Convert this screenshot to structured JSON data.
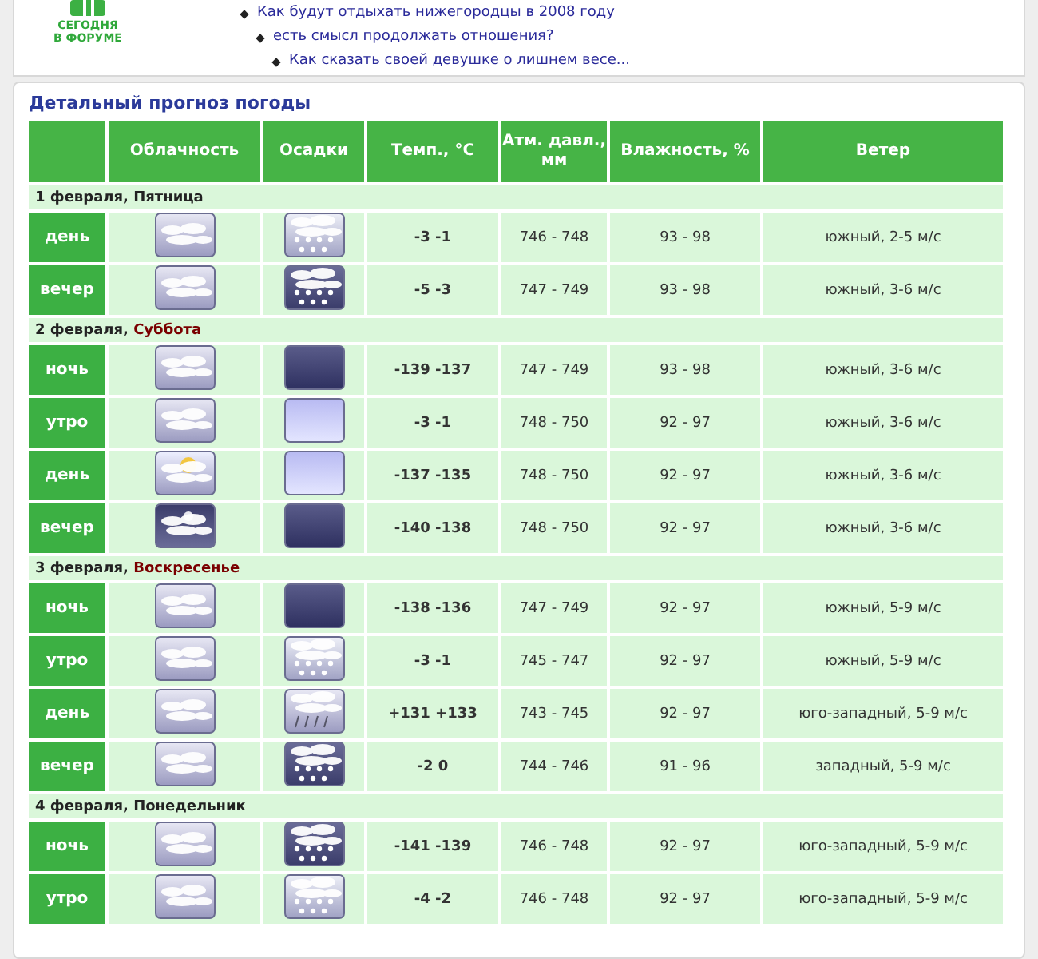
{
  "logo": {
    "lines": [
      "СЕГОДНЯ",
      "В ФОРУМЕ"
    ]
  },
  "forum_links": [
    {
      "text": "Как будут отдыхать нижегородцы в 2008 году",
      "children": [
        {
          "text": "есть смысл продолжать отношения?",
          "children": [
            {
              "text": "Как сказать своей девушке о лишнем весе..."
            }
          ]
        }
      ]
    }
  ],
  "forecast": {
    "title": "Детальный прогноз погоды",
    "columns": [
      "",
      "Облачность",
      "Осадки",
      "Темп., °C",
      "Атм. давл., мм",
      "Влажность, %",
      "Ветер"
    ],
    "days": [
      {
        "date": "1 февраля, ",
        "weekday": "Пятница",
        "weekend": false,
        "rows": [
          {
            "period": "день",
            "sky": {
              "kind": "cloudy"
            },
            "precip": {
              "kind": "snow"
            },
            "temp": "-3 -1",
            "pressure": "746 - 748",
            "humidity": "93 - 98",
            "wind": "южный, 2-5 м/с"
          },
          {
            "period": "вечер",
            "sky": {
              "kind": "cloudy"
            },
            "precip": {
              "kind": "heavysnow"
            },
            "temp": "-5 -3",
            "pressure": "747 - 749",
            "humidity": "93 - 98",
            "wind": "южный, 3-6 м/с"
          }
        ]
      },
      {
        "date": "2 февраля, ",
        "weekday": "Суббота",
        "weekend": true,
        "rows": [
          {
            "period": "ночь",
            "sky": {
              "kind": "cloudy"
            },
            "precip": {
              "kind": "dark"
            },
            "temp": "-139 -137",
            "pressure": "747 - 749",
            "humidity": "93 - 98",
            "wind": "южный, 3-6 м/с"
          },
          {
            "period": "утро",
            "sky": {
              "kind": "cloudy"
            },
            "precip": {
              "kind": "clear"
            },
            "temp": "-3 -1",
            "pressure": "748 - 750",
            "humidity": "92 - 97",
            "wind": "южный, 3-6 м/с"
          },
          {
            "period": "день",
            "sky": {
              "kind": "sunny"
            },
            "precip": {
              "kind": "clear"
            },
            "temp": "-137 -135",
            "pressure": "748 - 750",
            "humidity": "92 - 97",
            "wind": "южный, 3-6 м/с"
          },
          {
            "period": "вечер",
            "sky": {
              "kind": "night"
            },
            "precip": {
              "kind": "dark"
            },
            "temp": "-140 -138",
            "pressure": "748 - 750",
            "humidity": "92 - 97",
            "wind": "южный, 3-6 м/с"
          }
        ]
      },
      {
        "date": "3 февраля, ",
        "weekday": "Воскресенье",
        "weekend": true,
        "rows": [
          {
            "period": "ночь",
            "sky": {
              "kind": "cloudy"
            },
            "precip": {
              "kind": "dark"
            },
            "temp": "-138 -136",
            "pressure": "747 - 749",
            "humidity": "92 - 97",
            "wind": "южный, 5-9 м/с"
          },
          {
            "period": "утро",
            "sky": {
              "kind": "cloudy"
            },
            "precip": {
              "kind": "snow"
            },
            "temp": "-3 -1",
            "pressure": "745 - 747",
            "humidity": "92 - 97",
            "wind": "южный, 5-9 м/с"
          },
          {
            "period": "день",
            "sky": {
              "kind": "cloudy"
            },
            "precip": {
              "kind": "rain"
            },
            "temp": "+131 +133",
            "pressure": "743 - 745",
            "humidity": "92 - 97",
            "wind": "юго-западный, 5-9 м/с"
          },
          {
            "period": "вечер",
            "sky": {
              "kind": "cloudy"
            },
            "precip": {
              "kind": "heavysnow"
            },
            "temp": "-2 0",
            "pressure": "744 - 746",
            "humidity": "91 - 96",
            "wind": "западный, 5-9 м/с"
          }
        ]
      },
      {
        "date": "4 февраля, ",
        "weekday": "Понедельник",
        "weekend": false,
        "rows": [
          {
            "period": "ночь",
            "sky": {
              "kind": "cloudy"
            },
            "precip": {
              "kind": "heavysnow"
            },
            "temp": "-141 -139",
            "pressure": "746 - 748",
            "humidity": "92 - 97",
            "wind": "юго-западный, 5-9 м/с"
          },
          {
            "period": "утро",
            "sky": {
              "kind": "cloudy"
            },
            "precip": {
              "kind": "snow"
            },
            "temp": "-4 -2",
            "pressure": "746 - 748",
            "humidity": "92 - 97",
            "wind": "юго-западный, 5-9 м/с"
          }
        ]
      }
    ]
  }
}
